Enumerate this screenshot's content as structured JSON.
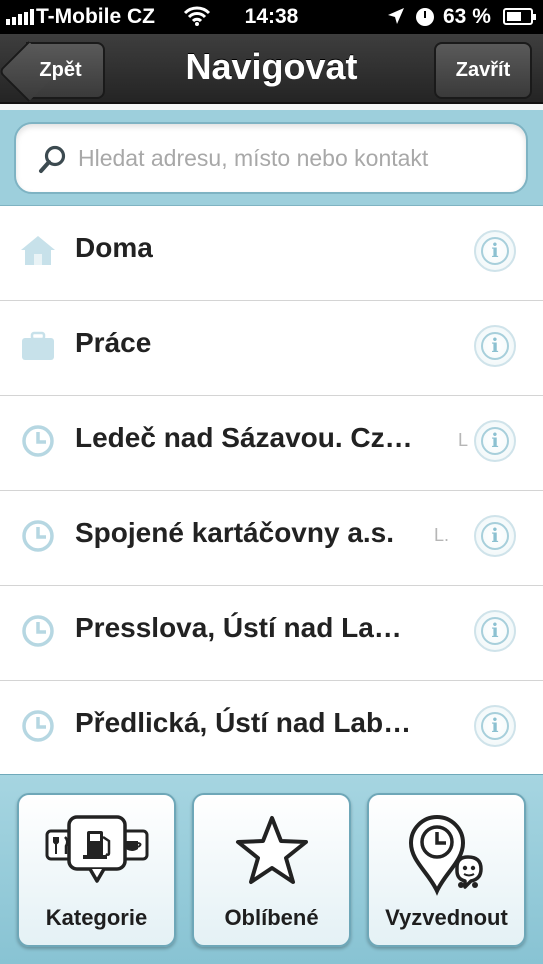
{
  "status_bar": {
    "carrier": "T-Mobile CZ",
    "time": "14:38",
    "battery_percent": "63 %",
    "battery_level": 0.63,
    "icons": [
      "signal-icon",
      "wifi-icon",
      "location-arrow-icon",
      "clock-icon",
      "battery-icon"
    ]
  },
  "nav": {
    "title": "Navigovat",
    "back_label": "Zpět",
    "close_label": "Zavřít"
  },
  "search": {
    "placeholder": "Hledat adresu, místo nebo kontakt",
    "value": ""
  },
  "list": {
    "items": [
      {
        "label": "Doma",
        "sublabel": "",
        "icon": "home-icon"
      },
      {
        "label": "Práce",
        "sublabel": "",
        "icon": "briefcase-icon"
      },
      {
        "label": "Ledeč nad Sázavou. Cz…",
        "sublabel": "L",
        "icon": "recent-clock-icon"
      },
      {
        "label": "Spojené kartáčovny a.s.",
        "sublabel": "L.",
        "icon": "recent-clock-icon"
      },
      {
        "label": "Presslova, Ústí nad La…",
        "sublabel": "",
        "icon": "recent-clock-icon"
      },
      {
        "label": "Předlická, Ústí nad Lab…",
        "sublabel": "",
        "icon": "recent-clock-icon"
      }
    ],
    "info_glyph": "i"
  },
  "bottom_bar": {
    "tiles": [
      {
        "label": "Kategorie",
        "icon": "categories-icon"
      },
      {
        "label": "Oblíbené",
        "icon": "star-icon"
      },
      {
        "label": "Vyzvednout",
        "icon": "pickup-clock-icon"
      }
    ]
  },
  "colors": {
    "accent": "#9dcfdc",
    "navbar": "#2f2f2f",
    "icon_blue": "#a7cfdb"
  }
}
